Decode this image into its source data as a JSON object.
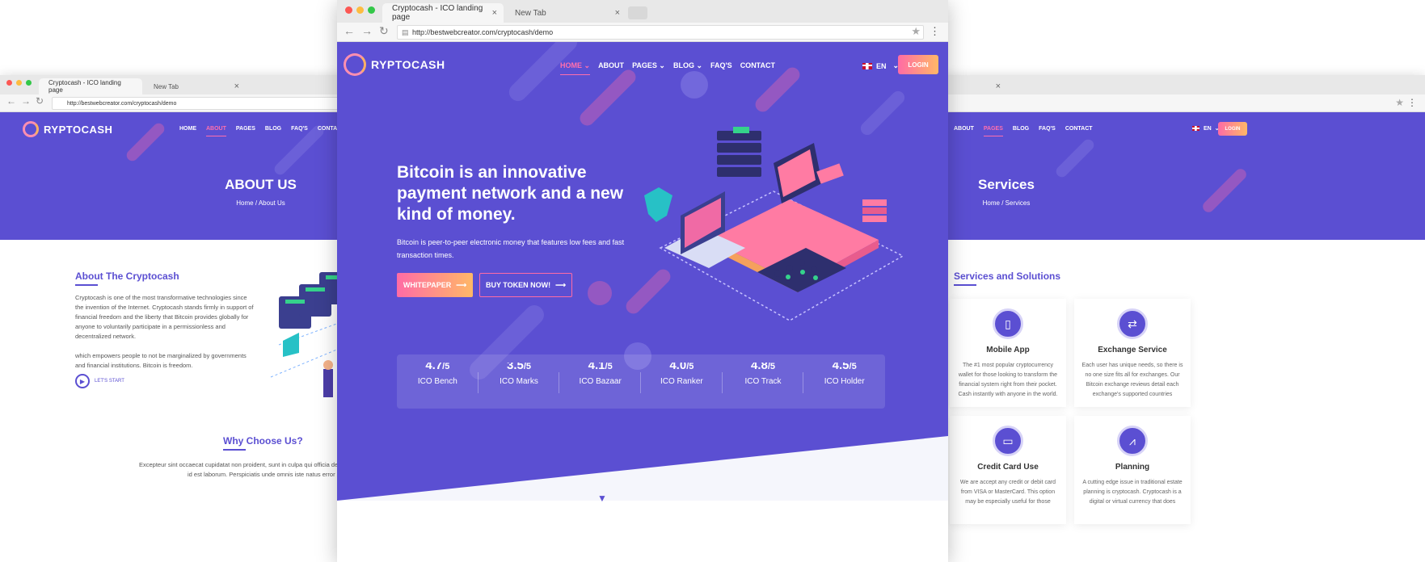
{
  "left": {
    "tabs": [
      {
        "label": "Cryptocash - ICO landing page"
      },
      {
        "label": "New Tab"
      }
    ],
    "url": "http://bestwebcreator.com/cryptocash/demo",
    "logo": "RYPTOCASH",
    "menu": [
      "HOME",
      "ABOUT",
      "PAGES",
      "BLOG",
      "FAQ'S",
      "CONTACT"
    ],
    "page_title": "ABOUT US",
    "breadcrumb_home": "Home",
    "breadcrumb_sep": "/",
    "breadcrumb_current": "About Us",
    "section_title": "About The Cryptocash",
    "para1": "Cryptocash is one of the most transformative technologies since the invention of the Internet. Cryptocash stands firmly in support of financial freedom and the liberty that Bitcoin provides globally for anyone to voluntarily participate in a permissionless and decentralized network.",
    "para2": "which empowers people to not be marginalized by governments and financial institutions. Bitcoin is freedom.",
    "lets_start": "LET'S START",
    "why_title": "Why Choose Us?",
    "why_text_1": "Excepteur sint occaecat cupidatat non proident, sunt in culpa qui officia dese",
    "why_text_2": "id est laborum. Perspiciatis unde omnis iste natus error sit"
  },
  "center": {
    "tabs": [
      {
        "label": "Cryptocash - ICO landing page"
      },
      {
        "label": "New Tab"
      }
    ],
    "url": "http://bestwebcreator.com/cryptocash/demo",
    "logo": "RYPTOCASH",
    "menu": [
      "HOME",
      "ABOUT",
      "PAGES",
      "BLOG",
      "FAQ'S",
      "CONTACT"
    ],
    "lang": "EN",
    "login": "LOGIN",
    "headline": "Bitcoin is an innovative payment network and a new kind of money.",
    "subtext": "Bitcoin is peer-to-peer electronic money that features low fees and fast transaction times.",
    "btn_whitepaper": "WHITEPAPER",
    "btn_buy": "BUY TOKEN NOW!",
    "stats": [
      {
        "value": "4.7",
        "suffix": "/5",
        "name": "ICO Bench"
      },
      {
        "value": "3.5",
        "suffix": "/5",
        "name": "ICO Marks"
      },
      {
        "value": "4.1",
        "suffix": "/5",
        "name": "ICO Bazaar"
      },
      {
        "value": "4.0",
        "suffix": "/5",
        "name": "ICO Ranker"
      },
      {
        "value": "4.8",
        "suffix": "/5",
        "name": "ICO Track"
      },
      {
        "value": "4.5",
        "suffix": "/5",
        "name": "ICO Holder"
      }
    ]
  },
  "right": {
    "menu": [
      "ABOUT",
      "PAGES",
      "BLOG",
      "FAQ'S",
      "CONTACT"
    ],
    "lang": "EN",
    "login": "LOGIN",
    "page_title": "Services",
    "breadcrumb_home": "Home",
    "breadcrumb_sep": "/",
    "breadcrumb_current": "Services",
    "section_title": "Services and Solutions",
    "cards": [
      {
        "title": "Mobile App",
        "text": "The #1 most popular cryptocurrency wallet for those looking to transform the financial system right from their pocket. Cash instantly with anyone in the world."
      },
      {
        "title": "Exchange Service",
        "text": "Each user has unique needs, so there is no one size fits all for exchanges. Our Bitcoin exchange reviews detail each exchange's supported countries"
      },
      {
        "title": "Credit Card Use",
        "text": "We are accept any credit or debit card from VISA or MasterCard. This option may be especially useful for those"
      },
      {
        "title": "Planning",
        "text": "A cutting edge issue in traditional estate planning is cryptocash. Cryptocash is a digital or virtual currency that does"
      }
    ]
  },
  "colors": {
    "primary": "#5b4fd2",
    "accent_pink": "#ff6ba5",
    "accent_orange": "#ffb867"
  }
}
